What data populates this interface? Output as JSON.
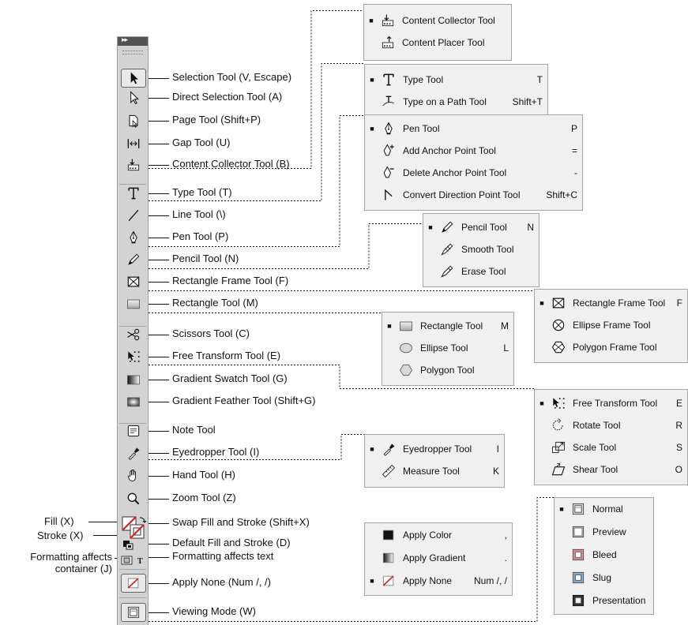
{
  "toolbar": {
    "tools": [
      {
        "icon": "selection-arrow-icon",
        "label": "Selection Tool  (V, Escape)"
      },
      {
        "icon": "direct-selection-icon",
        "label": "Direct Selection Tool  (A)"
      },
      {
        "icon": "page-tool-icon",
        "label": "Page Tool (Shift+P)"
      },
      {
        "icon": "gap-tool-icon",
        "label": "Gap Tool (U)"
      },
      {
        "icon": "content-collector-icon",
        "label": "Content Collector Tool (B)"
      },
      {
        "icon": "type-icon",
        "label": "Type Tool (T)"
      },
      {
        "icon": "line-icon",
        "label": "Line Tool (\\)"
      },
      {
        "icon": "pen-icon",
        "label": "Pen Tool (P)"
      },
      {
        "icon": "pencil-icon",
        "label": "Pencil Tool (N)"
      },
      {
        "icon": "rectangle-frame-icon",
        "label": "Rectangle Frame Tool (F)"
      },
      {
        "icon": "rectangle-icon",
        "label": "Rectangle Tool (M)"
      },
      {
        "icon": "scissors-icon",
        "label": "Scissors Tool (C)"
      },
      {
        "icon": "free-transform-icon",
        "label": "Free Transform Tool (E)"
      },
      {
        "icon": "gradient-swatch-icon",
        "label": "Gradient Swatch Tool (G)"
      },
      {
        "icon": "gradient-feather-icon",
        "label": "Gradient Feather Tool (Shift+G)"
      },
      {
        "icon": "note-icon",
        "label": "Note Tool"
      },
      {
        "icon": "eyedropper-icon",
        "label": "Eyedropper Tool (I)"
      },
      {
        "icon": "hand-icon",
        "label": "Hand Tool (H)"
      },
      {
        "icon": "zoom-icon",
        "label": "Zoom Tool (Z)"
      }
    ],
    "fill_stroke": [
      {
        "label": "Swap Fill and Stroke (Shift+X)"
      },
      {
        "label": "Default Fill and Stroke (D)"
      },
      {
        "label": "Formatting affects text"
      },
      {
        "label": "Apply None (Num /, /)"
      },
      {
        "label": "Viewing Mode (W)"
      }
    ],
    "left_labels": {
      "fill": "Fill (X)",
      "stroke": "Stroke (X)",
      "container_line1": "Formatting affects",
      "container_line2": "container (J)"
    }
  },
  "popups": {
    "content": [
      {
        "name": "Content Collector Tool",
        "key": "",
        "active": true,
        "icon": "content-collector-icon"
      },
      {
        "name": "Content Placer Tool",
        "key": "",
        "active": false,
        "icon": "content-placer-icon"
      }
    ],
    "type": [
      {
        "name": "Type Tool",
        "key": "T",
        "active": true,
        "icon": "type-icon"
      },
      {
        "name": "Type on a Path Tool",
        "key": "Shift+T",
        "active": false,
        "icon": "type-on-path-icon"
      }
    ],
    "pen": [
      {
        "name": "Pen Tool",
        "key": "P",
        "active": true,
        "icon": "pen-icon"
      },
      {
        "name": "Add Anchor Point Tool",
        "key": "=",
        "active": false,
        "icon": "add-anchor-icon"
      },
      {
        "name": "Delete Anchor Point Tool",
        "key": "-",
        "active": false,
        "icon": "delete-anchor-icon"
      },
      {
        "name": "Convert Direction Point Tool",
        "key": "Shift+C",
        "active": false,
        "icon": "convert-direction-icon"
      }
    ],
    "pencil": [
      {
        "name": "Pencil Tool",
        "key": "N",
        "active": true,
        "icon": "pencil-icon"
      },
      {
        "name": "Smooth Tool",
        "key": "",
        "active": false,
        "icon": "smooth-icon"
      },
      {
        "name": "Erase Tool",
        "key": "",
        "active": false,
        "icon": "erase-icon"
      }
    ],
    "frame": [
      {
        "name": "Rectangle Frame Tool",
        "key": "F",
        "active": true,
        "icon": "rectangle-frame-icon"
      },
      {
        "name": "Ellipse Frame Tool",
        "key": "",
        "active": false,
        "icon": "ellipse-frame-icon"
      },
      {
        "name": "Polygon Frame Tool",
        "key": "",
        "active": false,
        "icon": "polygon-frame-icon"
      }
    ],
    "shape": [
      {
        "name": "Rectangle Tool",
        "key": "M",
        "active": true,
        "icon": "rectangle-icon"
      },
      {
        "name": "Ellipse Tool",
        "key": "L",
        "active": false,
        "icon": "ellipse-icon"
      },
      {
        "name": "Polygon Tool",
        "key": "",
        "active": false,
        "icon": "polygon-icon"
      }
    ],
    "transform": [
      {
        "name": "Free Transform Tool",
        "key": "E",
        "active": true,
        "icon": "free-transform-icon"
      },
      {
        "name": "Rotate Tool",
        "key": "R",
        "active": false,
        "icon": "rotate-icon"
      },
      {
        "name": "Scale Tool",
        "key": "S",
        "active": false,
        "icon": "scale-icon"
      },
      {
        "name": "Shear Tool",
        "key": "O",
        "active": false,
        "icon": "shear-icon"
      }
    ],
    "eyedropper": [
      {
        "name": "Eyedropper Tool",
        "key": "I",
        "active": true,
        "icon": "eyedropper-icon"
      },
      {
        "name": "Measure Tool",
        "key": "K",
        "active": false,
        "icon": "measure-icon"
      }
    ],
    "apply": [
      {
        "name": "Apply Color",
        "key": ",",
        "active": false,
        "icon": "apply-color-icon"
      },
      {
        "name": "Apply Gradient",
        "key": ".",
        "active": false,
        "icon": "apply-gradient-icon"
      },
      {
        "name": "Apply None",
        "key": "Num /, /",
        "active": true,
        "icon": "apply-none-icon"
      }
    ],
    "view": [
      {
        "name": "Normal",
        "key": "",
        "active": true,
        "icon": "normal-mode-icon"
      },
      {
        "name": "Preview",
        "key": "",
        "active": false,
        "icon": "preview-mode-icon"
      },
      {
        "name": "Bleed",
        "key": "",
        "active": false,
        "icon": "bleed-mode-icon"
      },
      {
        "name": "Slug",
        "key": "",
        "active": false,
        "icon": "slug-mode-icon"
      },
      {
        "name": "Presentation",
        "key": "",
        "active": false,
        "icon": "presentation-mode-icon"
      }
    ]
  },
  "colors": {
    "none_red": "#d32020",
    "panel": "#d3d3d3",
    "popup": "#f0f0f0"
  }
}
